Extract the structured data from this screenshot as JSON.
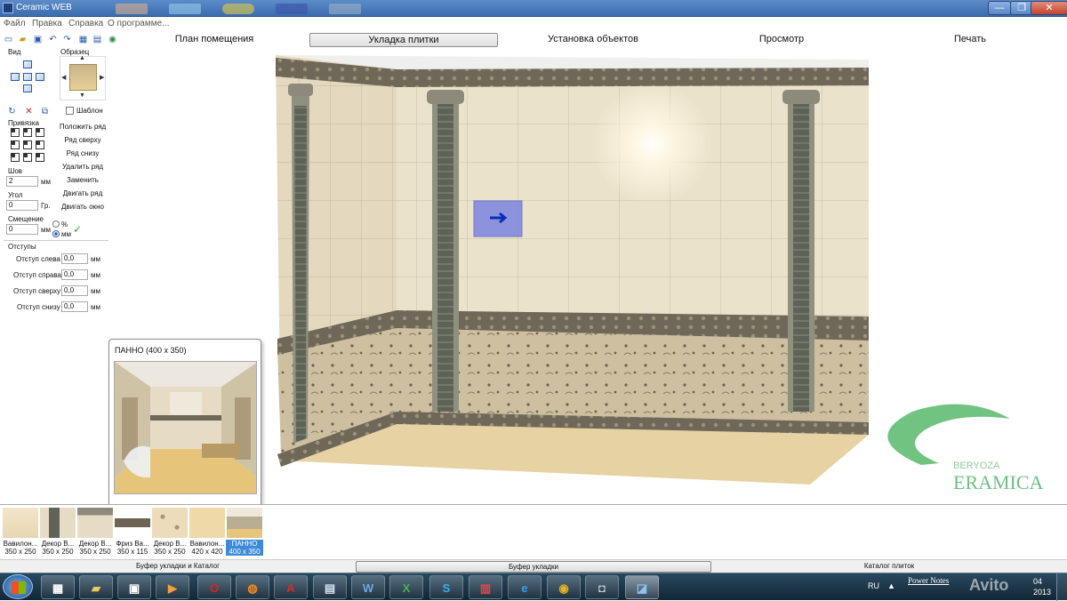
{
  "window": {
    "title": "Ceramic WEB",
    "minimize": "—",
    "maximize": "❐",
    "close": "✕"
  },
  "menu": [
    "Файл",
    "Правка",
    "Справка",
    "О программе..."
  ],
  "main_tabs": [
    "План помещения",
    "Укладка плитки",
    "Установка объектов",
    "Просмотр",
    "Печать"
  ],
  "active_tab_index": 1,
  "left_panel": {
    "view_label": "Вид",
    "sample_label": "Образец",
    "template_label": "Шаблон",
    "anchor_label": "Привязка",
    "row_buttons": [
      "Положить ряд",
      "Ряд сверху",
      "Ряд снизу",
      "Удалить ряд",
      "Заменить",
      "Двигать ряд",
      "Двигать окно"
    ],
    "seam": {
      "label": "Шов",
      "value": "2",
      "unit": "мм"
    },
    "angle": {
      "label": "Угол",
      "value": "0",
      "unit": "Гр."
    },
    "offset": {
      "label": "Смещение",
      "value": "0",
      "unit": "мм",
      "radio_percent": "%",
      "radio_mm": "мм"
    },
    "indents": {
      "title": "Отступы",
      "rows": [
        {
          "label": "Отступ слева",
          "value": "0,0",
          "unit": "мм"
        },
        {
          "label": "Отступ справа",
          "value": "0,0",
          "unit": "мм"
        },
        {
          "label": "Отступ сверху",
          "value": "0,0",
          "unit": "мм"
        },
        {
          "label": "Отступ снизу",
          "value": "0,0",
          "unit": "мм"
        }
      ]
    }
  },
  "popup": {
    "title": "ПАННО (400 x 350)"
  },
  "thumbnails": [
    {
      "name": "Вавилон...",
      "size": "350 x 250",
      "color": "#efe0c0"
    },
    {
      "name": "Декор В...",
      "size": "350 x 250",
      "color": "#6e6a5a"
    },
    {
      "name": "Декор В...",
      "size": "350 x 250",
      "color": "#8a8475"
    },
    {
      "name": "Фриз Ва...",
      "size": "350 x 115",
      "color": "#6d6354"
    },
    {
      "name": "Декор В...",
      "size": "350 x 250",
      "color": "#e8d8b4"
    },
    {
      "name": "Вавилон...",
      "size": "420 x 420",
      "color": "#f0d9a8"
    },
    {
      "name": "ПАННО",
      "size": "400 x 350",
      "color": "#b9ad93",
      "selected": true
    }
  ],
  "bottom_tabs": [
    "Буфер укладки и Каталог",
    "Буфер укладки",
    "Каталог плиток"
  ],
  "logo": {
    "top": "BERYOZA",
    "bottom": "ERAMICA"
  },
  "taskbar": {
    "lang": "RU",
    "app": "Power Notes",
    "date": "04",
    "year": "2013",
    "watermark": "Avito"
  },
  "colors": {
    "accent": "#3b6fb3",
    "wall": "#ece3cf",
    "floor": "#ead7a8",
    "decor": "#7d7562",
    "selected": "#3d8bd8"
  }
}
